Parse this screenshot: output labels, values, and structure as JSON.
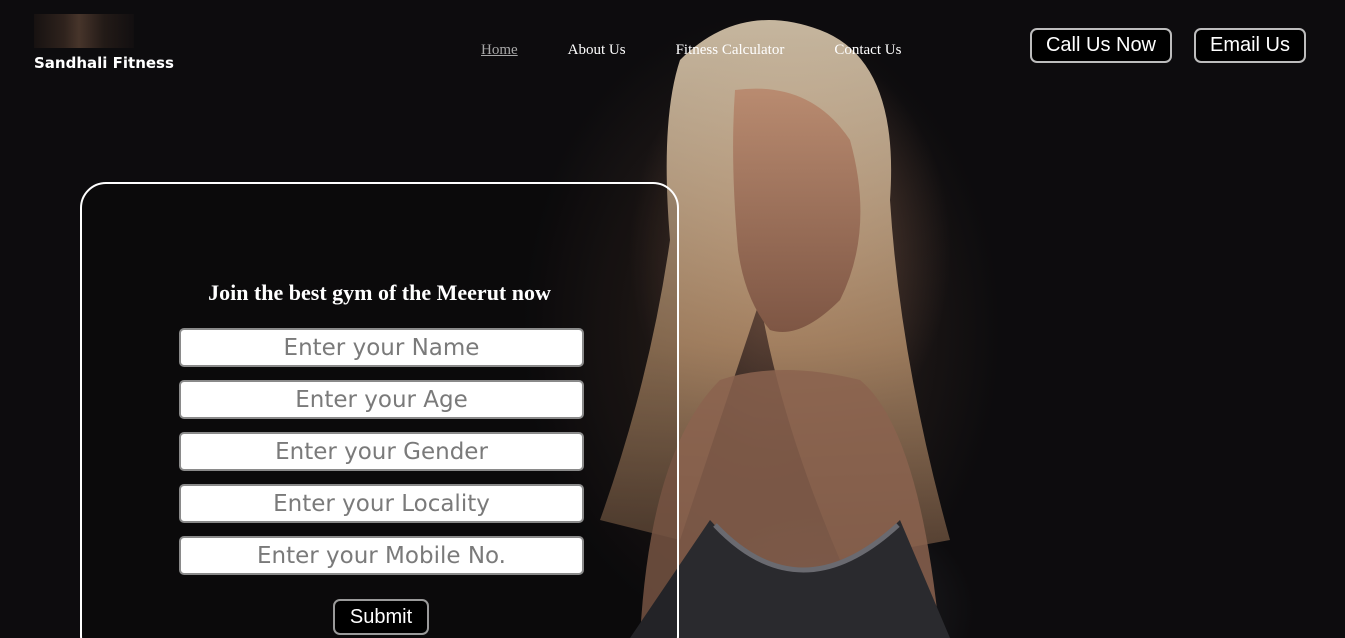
{
  "brand": {
    "name": "Sandhali Fitness"
  },
  "nav": {
    "items": [
      {
        "label": "Home",
        "active": true
      },
      {
        "label": "About Us",
        "active": false
      },
      {
        "label": "Fitness Calculator",
        "active": false
      },
      {
        "label": "Contact Us",
        "active": false
      }
    ]
  },
  "header_buttons": {
    "call": "Call Us Now",
    "email": "Email Us"
  },
  "form": {
    "title": "Join the best gym of the Meerut now",
    "fields": [
      {
        "placeholder": "Enter your Name",
        "value": ""
      },
      {
        "placeholder": "Enter your Age",
        "value": ""
      },
      {
        "placeholder": "Enter your Gender",
        "value": ""
      },
      {
        "placeholder": "Enter your Locality",
        "value": ""
      },
      {
        "placeholder": "Enter your Mobile No.",
        "value": ""
      }
    ],
    "submit_label": "Submit"
  },
  "colors": {
    "background": "#0d0c0e",
    "text": "#ffffff",
    "nav_active": "#a8a8a8",
    "button_bg": "#000000"
  }
}
